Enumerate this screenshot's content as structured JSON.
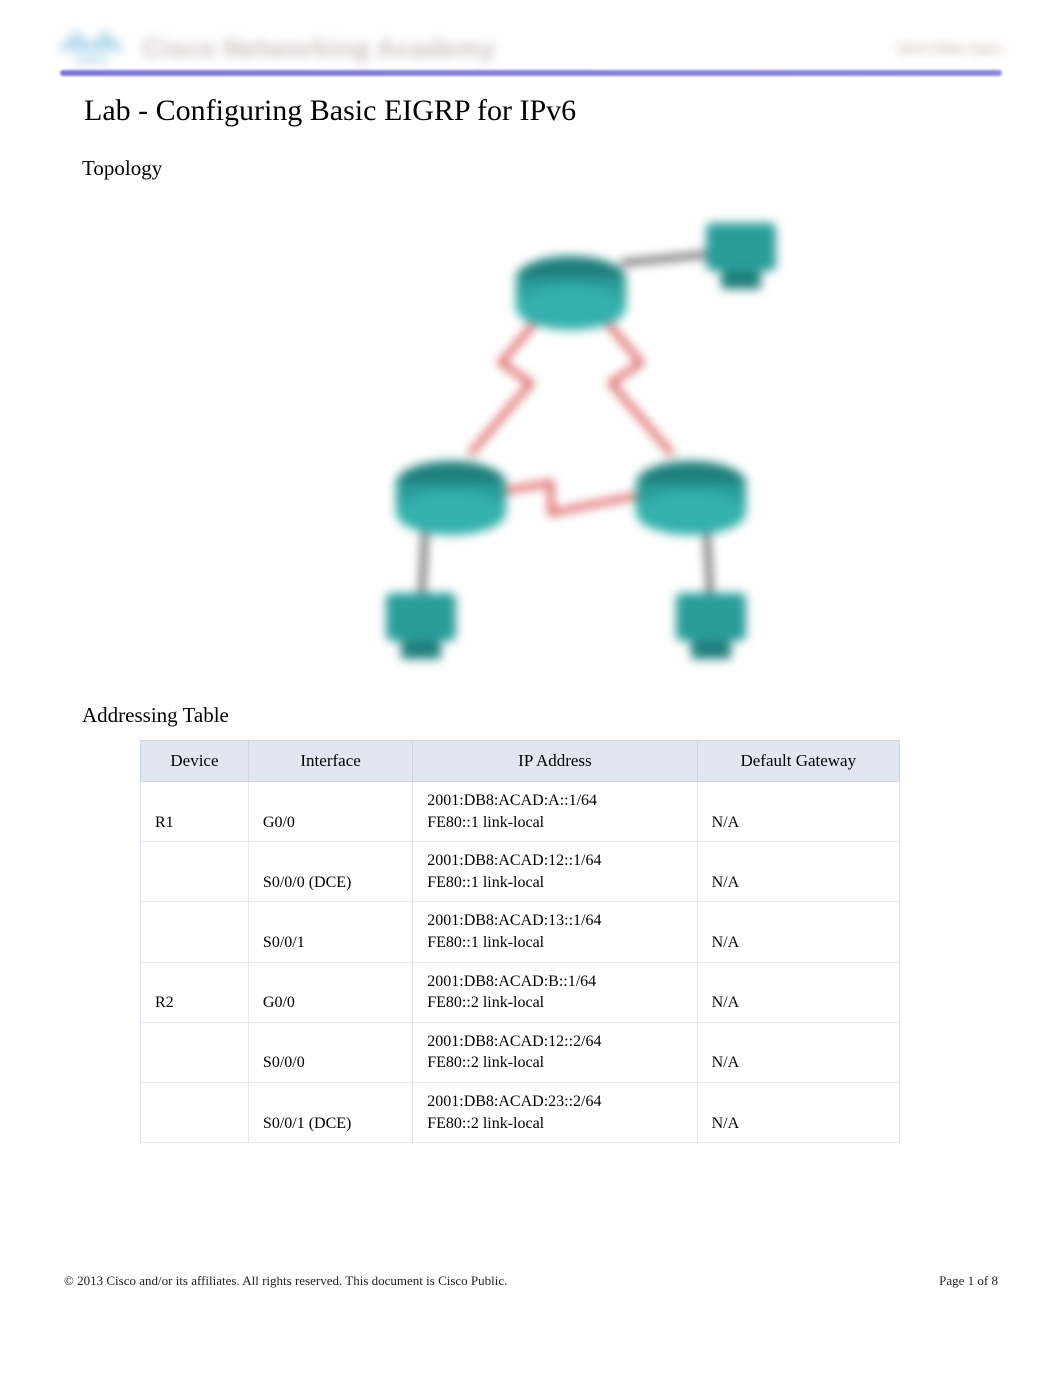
{
  "brand": {
    "logo_word": "cisco",
    "academy_text": "Cisco Networking Academy",
    "right_text": "Mind Wide Open"
  },
  "doc": {
    "title": "Lab - Configuring Basic EIGRP for IPv6",
    "section_topology": "Topology",
    "section_addressing": "Addressing Table"
  },
  "addr_table": {
    "headers": {
      "device": "Device",
      "interface": "Interface",
      "ip": "IP Address",
      "gateway": "Default Gateway"
    },
    "rows": [
      {
        "device": "R1",
        "interface": "G0/0",
        "ip": "2001:DB8:ACAD:A::1/64\nFE80::1 link-local",
        "gateway": "N/A"
      },
      {
        "device": "",
        "interface": "S0/0/0 (DCE)",
        "ip": "2001:DB8:ACAD:12::1/64\nFE80::1 link-local",
        "gateway": "N/A"
      },
      {
        "device": "",
        "interface": "S0/0/1",
        "ip": "2001:DB8:ACAD:13::1/64\nFE80::1 link-local",
        "gateway": "N/A"
      },
      {
        "device": "R2",
        "interface": "G0/0",
        "ip": "2001:DB8:ACAD:B::1/64\nFE80::2 link-local",
        "gateway": "N/A"
      },
      {
        "device": "",
        "interface": "S0/0/0",
        "ip": "2001:DB8:ACAD:12::2/64\nFE80::2 link-local",
        "gateway": "N/A"
      },
      {
        "device": "",
        "interface": "S0/0/1 (DCE)",
        "ip": "2001:DB8:ACAD:23::2/64\nFE80::2 link-local",
        "gateway": "N/A"
      }
    ]
  },
  "footer": {
    "copyright": "© 2013 Cisco and/or its affiliates. All rights reserved. This document is Cisco Public.",
    "page_label": "Page  1 of 8"
  },
  "colors": {
    "brand_blue": "#1b8bc7",
    "brand_rule": "#6a5fcf",
    "table_header_bg": "#e1e7f0",
    "router_teal": "#2a8f8f",
    "link_red": "#d43d3d"
  }
}
